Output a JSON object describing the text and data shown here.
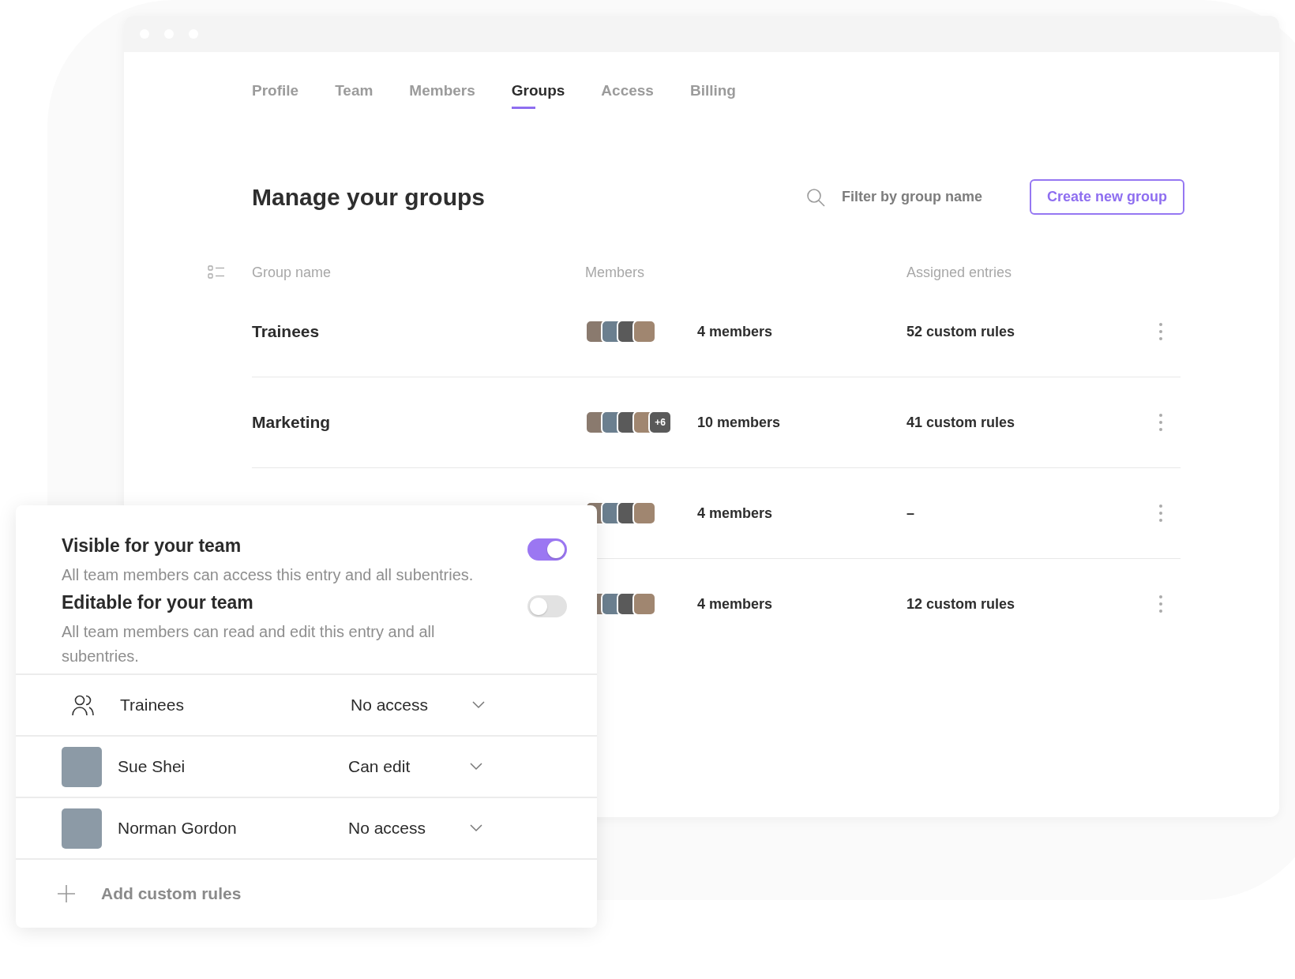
{
  "tabs": [
    {
      "label": "Profile",
      "selected": false
    },
    {
      "label": "Team",
      "selected": false
    },
    {
      "label": "Members",
      "selected": false
    },
    {
      "label": "Groups",
      "selected": true
    },
    {
      "label": "Access",
      "selected": false
    },
    {
      "label": "Billing",
      "selected": false
    }
  ],
  "heading": "Manage your groups",
  "search": {
    "placeholder": "Filter by group name"
  },
  "create_button": "Create new group",
  "table": {
    "columns": [
      "Group name",
      "Members",
      "Assigned entries"
    ],
    "rows": [
      {
        "name": "Trainees",
        "avatars": [
          {
            "kind": "photo"
          },
          {
            "kind": "photo"
          },
          {
            "kind": "photo"
          },
          {
            "kind": "photo"
          }
        ],
        "members": "4 members",
        "entries": "52 custom rules"
      },
      {
        "name": "Marketing",
        "avatars": [
          {
            "kind": "photo"
          },
          {
            "kind": "photo"
          },
          {
            "kind": "photo"
          },
          {
            "kind": "photo"
          },
          {
            "kind": "more",
            "label": "+6"
          }
        ],
        "members": "10 members",
        "entries": "41 custom rules"
      },
      {
        "avatars": [
          {
            "kind": "photo"
          },
          {
            "kind": "photo"
          },
          {
            "kind": "photo"
          },
          {
            "kind": "photo"
          }
        ],
        "members": "4 members",
        "entries": "–"
      },
      {
        "avatars": [
          {
            "kind": "photo"
          },
          {
            "kind": "photo"
          },
          {
            "kind": "photo"
          },
          {
            "kind": "photo"
          }
        ],
        "members": "4 members",
        "entries": "12 custom rules"
      }
    ]
  },
  "panel": {
    "settings": [
      {
        "title": "Visible for your team",
        "description": "All team members can access this entry and all subentries.",
        "on": true
      },
      {
        "title": "Editable for your team",
        "description": "All team members can read and edit this entry and all subentries.",
        "on": false
      }
    ],
    "rules": [
      {
        "kind": "group",
        "name": "Trainees",
        "access": "No access"
      },
      {
        "kind": "person",
        "name": "Sue Shei",
        "access": "Can edit"
      },
      {
        "kind": "person",
        "name": "Norman Gordon",
        "access": "No access"
      }
    ],
    "add_label": "Add custom rules"
  }
}
